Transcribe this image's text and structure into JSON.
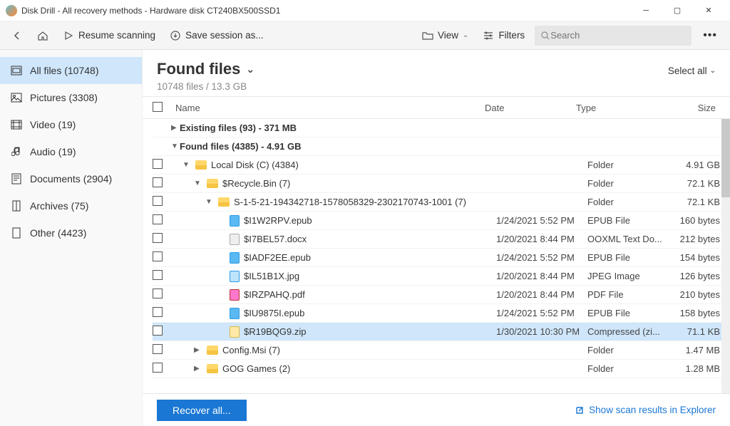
{
  "window": {
    "title": "Disk Drill - All recovery methods - Hardware disk CT240BX500SSD1"
  },
  "toolbar": {
    "resume": "Resume scanning",
    "save_session": "Save session as...",
    "view": "View",
    "filters": "Filters",
    "search_placeholder": "Search"
  },
  "sidebar": {
    "items": [
      {
        "label": "All files (10748)"
      },
      {
        "label": "Pictures (3308)"
      },
      {
        "label": "Video (19)"
      },
      {
        "label": "Audio (19)"
      },
      {
        "label": "Documents (2904)"
      },
      {
        "label": "Archives (75)"
      },
      {
        "label": "Other (4423)"
      }
    ]
  },
  "header": {
    "title": "Found files",
    "subtitle": "10748 files / 13.3 GB",
    "select_all": "Select all"
  },
  "columns": {
    "name": "Name",
    "date": "Date",
    "type": "Type",
    "size": "Size"
  },
  "groups": {
    "existing": "Existing files (93) - 371 MB",
    "found": "Found files (4385) - 4.91 GB"
  },
  "tree": [
    {
      "indent": 1,
      "expand": "▼",
      "icon": "folder",
      "name": "Local Disk (C) (4384)",
      "date": "",
      "type": "Folder",
      "size": "4.91 GB"
    },
    {
      "indent": 2,
      "expand": "▼",
      "icon": "folder",
      "name": "$Recycle.Bin (7)",
      "date": "",
      "type": "Folder",
      "size": "72.1 KB"
    },
    {
      "indent": 3,
      "expand": "▼",
      "icon": "folder",
      "name": "S-1-5-21-194342718-1578058329-2302170743-1001 (7)",
      "date": "",
      "type": "Folder",
      "size": "72.1 KB"
    },
    {
      "indent": 4,
      "expand": "",
      "icon": "ep",
      "name": "$I1W2RPV.epub",
      "date": "1/24/2021 5:52 PM",
      "type": "EPUB File",
      "size": "160 bytes"
    },
    {
      "indent": 4,
      "expand": "",
      "icon": "doc",
      "name": "$I7BEL57.docx",
      "date": "1/20/2021 8:44 PM",
      "type": "OOXML Text Do...",
      "size": "212 bytes"
    },
    {
      "indent": 4,
      "expand": "",
      "icon": "ep",
      "name": "$IADF2EE.epub",
      "date": "1/24/2021 5:52 PM",
      "type": "EPUB File",
      "size": "154 bytes"
    },
    {
      "indent": 4,
      "expand": "",
      "icon": "jpg",
      "name": "$IL51B1X.jpg",
      "date": "1/20/2021 8:44 PM",
      "type": "JPEG Image",
      "size": "126 bytes"
    },
    {
      "indent": 4,
      "expand": "",
      "icon": "pdf",
      "name": "$IRZPAHQ.pdf",
      "date": "1/20/2021 8:44 PM",
      "type": "PDF File",
      "size": "210 bytes"
    },
    {
      "indent": 4,
      "expand": "",
      "icon": "ep",
      "name": "$IU9875I.epub",
      "date": "1/24/2021 5:52 PM",
      "type": "EPUB File",
      "size": "158 bytes"
    },
    {
      "indent": 4,
      "expand": "",
      "icon": "zip",
      "name": "$R19BQG9.zip",
      "date": "1/30/2021 10:30 PM",
      "type": "Compressed (zi...",
      "size": "71.1 KB",
      "selected": true
    },
    {
      "indent": 2,
      "expand": "▶",
      "icon": "folder",
      "name": "Config.Msi (7)",
      "date": "",
      "type": "Folder",
      "size": "1.47 MB"
    },
    {
      "indent": 2,
      "expand": "▶",
      "icon": "folder",
      "name": "GOG Games (2)",
      "date": "",
      "type": "Folder",
      "size": "1.28 MB"
    }
  ],
  "footer": {
    "recover": "Recover all...",
    "explorer_link": "Show scan results in Explorer"
  }
}
